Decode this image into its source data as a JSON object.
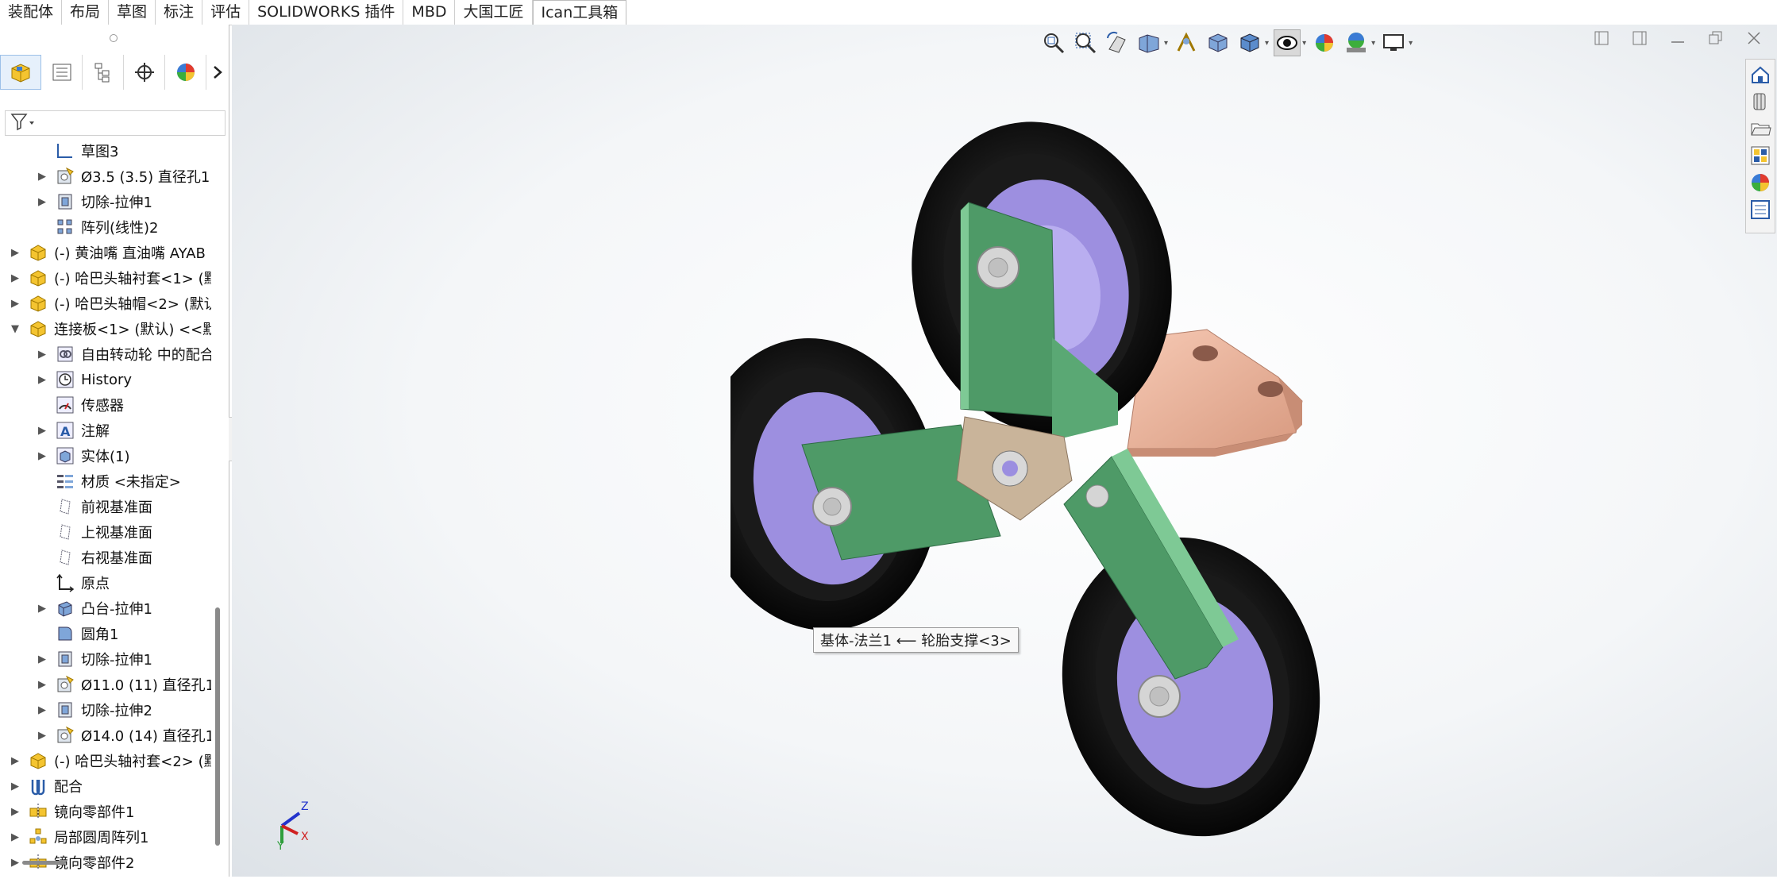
{
  "tabs": [
    "装配体",
    "布局",
    "草图",
    "标注",
    "评估",
    "SOLIDWORKS 插件",
    "MBD",
    "大国工匠",
    "Ican工具箱"
  ],
  "active_tab_index": 8,
  "panel_tabs": [
    "featuremanager-icon",
    "propertymanager-icon",
    "configurationmanager-icon",
    "dimxpert-icon",
    "display-manager-icon"
  ],
  "filter_icon": "filter-icon",
  "tree": [
    {
      "label": "草图3",
      "indent": 2,
      "expander": false,
      "icon": "sketch-icon"
    },
    {
      "label": "Ø3.5 (3.5) 直径孔1",
      "indent": 2,
      "expander": true,
      "icon": "hole-wizard-icon"
    },
    {
      "label": "切除-拉伸1",
      "indent": 2,
      "expander": true,
      "icon": "cut-extrude-icon"
    },
    {
      "label": "阵列(线性)2",
      "indent": 2,
      "expander": false,
      "icon": "linear-pattern-icon"
    },
    {
      "label": "(-) 黄油嘴 直油嘴  AYAB",
      "indent": 1,
      "expander": true,
      "icon": "part-icon"
    },
    {
      "label": "(-) 哈巴头轴衬套<1> (默",
      "indent": 1,
      "expander": true,
      "icon": "part-icon"
    },
    {
      "label": "(-) 哈巴头轴帽<2> (默认",
      "indent": 1,
      "expander": true,
      "icon": "part-icon"
    },
    {
      "label": "连接板<1> (默认) <<默",
      "indent": 1,
      "expander": "open",
      "icon": "part-icon"
    },
    {
      "label": "自由转动轮 中的配合",
      "indent": 2,
      "expander": true,
      "icon": "mates-folder-icon"
    },
    {
      "label": "History",
      "indent": 2,
      "expander": true,
      "icon": "history-icon"
    },
    {
      "label": "传感器",
      "indent": 2,
      "expander": false,
      "icon": "sensor-icon"
    },
    {
      "label": "注解",
      "indent": 2,
      "expander": true,
      "icon": "annotation-icon"
    },
    {
      "label": "实体(1)",
      "indent": 2,
      "expander": true,
      "icon": "solid-bodies-icon"
    },
    {
      "label": "材质 <未指定>",
      "indent": 2,
      "expander": false,
      "icon": "material-icon"
    },
    {
      "label": "前视基准面",
      "indent": 2,
      "expander": false,
      "icon": "plane-icon"
    },
    {
      "label": "上视基准面",
      "indent": 2,
      "expander": false,
      "icon": "plane-icon"
    },
    {
      "label": "右视基准面",
      "indent": 2,
      "expander": false,
      "icon": "plane-icon"
    },
    {
      "label": "原点",
      "indent": 2,
      "expander": false,
      "icon": "origin-icon"
    },
    {
      "label": "凸台-拉伸1",
      "indent": 2,
      "expander": true,
      "icon": "boss-extrude-icon"
    },
    {
      "label": "圆角1",
      "indent": 2,
      "expander": false,
      "icon": "fillet-icon"
    },
    {
      "label": "切除-拉伸1",
      "indent": 2,
      "expander": true,
      "icon": "cut-extrude-icon"
    },
    {
      "label": "Ø11.0 (11) 直径孔1",
      "indent": 2,
      "expander": true,
      "icon": "hole-wizard-icon"
    },
    {
      "label": "切除-拉伸2",
      "indent": 2,
      "expander": true,
      "icon": "cut-extrude-icon"
    },
    {
      "label": "Ø14.0 (14) 直径孔1",
      "indent": 2,
      "expander": true,
      "icon": "hole-wizard-icon"
    },
    {
      "label": "(-) 哈巴头轴衬套<2> (默",
      "indent": 1,
      "expander": true,
      "icon": "part-icon"
    },
    {
      "label": "配合",
      "indent": 1,
      "expander": true,
      "icon": "mates-icon"
    },
    {
      "label": "镜向零部件1",
      "indent": 1,
      "expander": true,
      "icon": "mirror-component-icon"
    },
    {
      "label": "局部圆周阵列1",
      "indent": 1,
      "expander": true,
      "icon": "circular-pattern-icon"
    },
    {
      "label": "镜向零部件2",
      "indent": 1,
      "expander": true,
      "icon": "mirror-component-icon"
    }
  ],
  "hud_toolbar": [
    "zoom-to-fit-icon",
    "zoom-to-area-icon",
    "previous-view-icon",
    "section-view-icon",
    "dynamic-annotation-icon",
    "view-orientation-icon",
    "display-style-icon",
    "hide-show-items-icon",
    "edit-appearance-icon",
    "apply-scene-icon",
    "view-settings-icon"
  ],
  "window_controls": [
    "tile-left-icon",
    "tile-right-icon",
    "minimize-icon",
    "restore-icon",
    "close-icon"
  ],
  "task_pane": [
    "solidworks-resources-icon",
    "design-library-icon",
    "file-explorer-icon",
    "view-palette-icon",
    "appearances-icon",
    "custom-properties-icon"
  ],
  "tooltip": "基体-法兰1 ⟵ 轮胎支撑<3>",
  "triad": {
    "x": "X",
    "y": "Y",
    "z": "Z"
  },
  "colors": {
    "bracket": "#4e9a67",
    "tire": "#111111",
    "hub": "#9d8fe0",
    "plate": "#f0b8a0",
    "center": "#c9b49a"
  }
}
